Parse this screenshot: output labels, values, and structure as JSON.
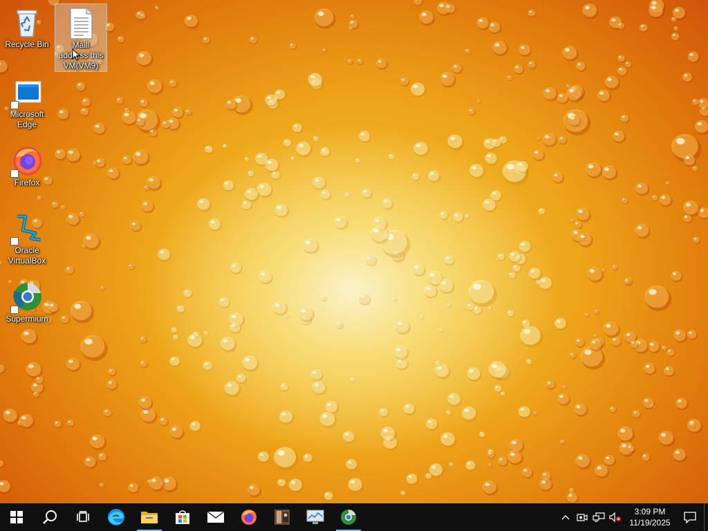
{
  "desktop": {
    "icons": [
      {
        "label": "Recycle Bin",
        "icon": "recycle-bin-icon"
      },
      {
        "label": "Maill address this VM(VM9)",
        "icon": "text-document-icon",
        "selected": true
      },
      {
        "label": "Microsoft Edge",
        "icon": "edge-icon",
        "shortcut": true
      },
      {
        "label": "Firefox",
        "icon": "firefox-icon",
        "shortcut": true
      },
      {
        "label": "Oracle VirtualBox",
        "icon": "virtualbox-icon",
        "shortcut": true
      },
      {
        "label": "Supermium",
        "icon": "supermium-icon",
        "shortcut": true
      }
    ],
    "wallpaper": "orange water drops"
  },
  "taskbar": {
    "buttons": [
      {
        "name": "start-button",
        "icon": "windows-logo-icon"
      },
      {
        "name": "search-button",
        "icon": "search-icon"
      },
      {
        "name": "task-view-button",
        "icon": "task-view-icon"
      },
      {
        "name": "edge-taskbar-button",
        "icon": "edge-icon"
      },
      {
        "name": "file-explorer-taskbar-button",
        "icon": "folder-icon",
        "running": true
      },
      {
        "name": "microsoft-store-taskbar-button",
        "icon": "store-icon"
      },
      {
        "name": "mail-taskbar-button",
        "icon": "mail-icon"
      },
      {
        "name": "firefox-taskbar-button",
        "icon": "firefox-icon"
      },
      {
        "name": "app-taskbar-button",
        "icon": "app-icon"
      },
      {
        "name": "task-manager-taskbar-button",
        "icon": "monitor-icon"
      },
      {
        "name": "supermium-taskbar-button",
        "icon": "supermium-icon",
        "running": true
      }
    ],
    "tray": {
      "icons": [
        "chevron-up-icon",
        "camera-icon",
        "network-icon",
        "volume-muted-icon"
      ],
      "time": "3:09 PM",
      "date": "11/19/2025"
    }
  },
  "colors": {
    "taskbar": "#101010",
    "accent_underline": "#76b9ed",
    "wallpaper_center": "#fbf2c9",
    "wallpaper_edge": "#d1560a"
  }
}
